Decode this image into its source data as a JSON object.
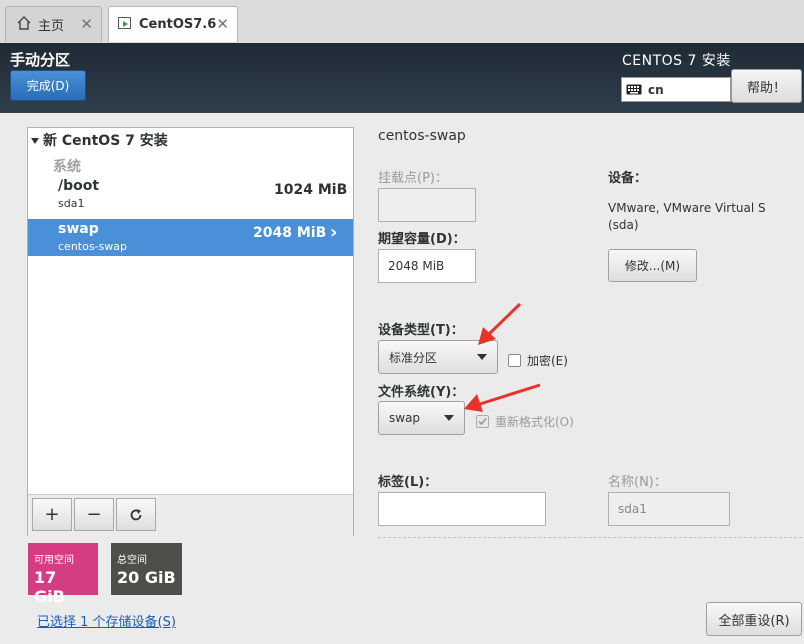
{
  "tabs": [
    {
      "label": "主页",
      "icon": "home-icon"
    },
    {
      "label": "CentOS7.6",
      "icon": "vm-icon"
    }
  ],
  "header": {
    "title": "手动分区",
    "done_label": "完成(D)",
    "brand": "CENTOS 7 安装",
    "keyboard_layout": "cn",
    "help_label": "帮助！"
  },
  "left": {
    "install_title": "新 CentOS 7 安装",
    "system_label": "系统",
    "partitions": [
      {
        "mount": "/boot",
        "device": "sda1",
        "size": "1024 MiB"
      },
      {
        "mount": "swap",
        "device": "centos-swap",
        "size": "2048 MiB",
        "selected": true
      }
    ],
    "available_label": "可用空间",
    "available_value": "17 GiB",
    "total_label": "总空间",
    "total_value": "20 GiB",
    "selected_devices_link": "已选择 1 个存储设备(S)"
  },
  "detail": {
    "title": "centos-swap",
    "mount_point_label": "挂载点(P)：",
    "mount_point_value": "",
    "capacity_label": "期望容量(D)：",
    "capacity_value": "2048 MiB",
    "device_label": "设备：",
    "device_value": "VMware, VMware Virtual S\n(sda)",
    "modify_label": "修改...(M)",
    "device_type_label": "设备类型(T)：",
    "device_type_value": "标准分区",
    "encrypt_label": "加密(E)",
    "filesystem_label": "文件系统(Y)：",
    "filesystem_value": "swap",
    "reformat_label": "重新格式化(O)",
    "tag_label": "标签(L)：",
    "tag_value": "",
    "name_label": "名称(N)：",
    "name_value": "sda1",
    "reset_label": "全部重设(R)"
  },
  "colors": {
    "selected_row": "#4a90d9",
    "available_badge": "#d63c82",
    "total_badge": "#4e4e4a",
    "annotation_arrow": "#e8332b"
  }
}
